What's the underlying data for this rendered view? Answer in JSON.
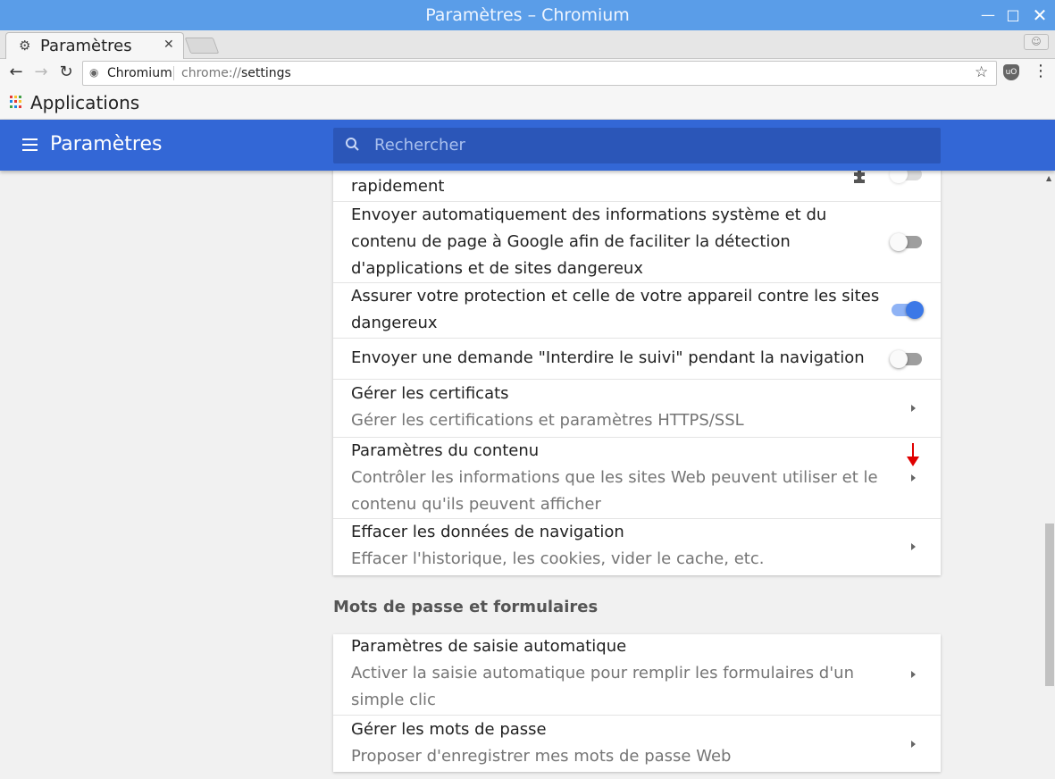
{
  "window": {
    "title": "Paramètres – Chromium"
  },
  "tab": {
    "title": "Paramètres",
    "icon": "gear-icon"
  },
  "omnibox": {
    "site_name": "Chromium",
    "url_scheme": "chrome://",
    "url_path": "settings"
  },
  "bookmarks": {
    "apps_label": "Applications",
    "apps_colors": [
      "#e53935",
      "#fbc02d",
      "#43a047",
      "#1e88e5",
      "#e53935",
      "#fbc02d",
      "#43a047",
      "#1e88e5",
      "#e53935"
    ]
  },
  "header": {
    "title": "Paramètres",
    "search_placeholder": "Rechercher",
    "color": "#3367d6"
  },
  "privacy_card": {
    "rows": [
      {
        "lines": [
          "rapidement"
        ],
        "control": "toggle",
        "state": "off",
        "managed_by_extension": true
      },
      {
        "lines": [
          "Envoyer automatiquement des informations système et du",
          "contenu de page à Google afin de faciliter la détection",
          "d'applications et de sites dangereux"
        ],
        "control": "toggle",
        "state": "off"
      },
      {
        "lines": [
          "Assurer votre protection et celle de votre appareil contre les sites",
          "dangereux"
        ],
        "control": "toggle",
        "state": "on"
      },
      {
        "lines": [
          "Envoyer une demande \"Interdire le suivi\" pendant la navigation"
        ],
        "control": "toggle",
        "state": "off"
      },
      {
        "title": "Gérer les certificats",
        "subtitle": [
          "Gérer les certifications et paramètres HTTPS/SSL"
        ],
        "control": "arrow"
      },
      {
        "title": "Paramètres du contenu",
        "subtitle": [
          "Contrôler les informations que les sites Web peuvent utiliser et le",
          "contenu qu'ils peuvent afficher"
        ],
        "control": "arrow"
      },
      {
        "title": "Effacer les données de navigation",
        "subtitle": [
          "Effacer l'historique, les cookies, vider le cache, etc."
        ],
        "control": "arrow"
      }
    ]
  },
  "passwords_section": {
    "title": "Mots de passe et formulaires",
    "rows": [
      {
        "title": "Paramètres de saisie automatique",
        "subtitle": [
          "Activer la saisie automatique pour remplir les formulaires d'un",
          "simple clic"
        ],
        "control": "arrow"
      },
      {
        "title": "Gérer les mots de passe",
        "subtitle": [
          "Proposer d'enregistrer mes mots de passe Web"
        ],
        "control": "arrow"
      }
    ]
  },
  "colors": {
    "toggle_on": "#3b78e7",
    "annotation_arrow": "#e00000"
  }
}
